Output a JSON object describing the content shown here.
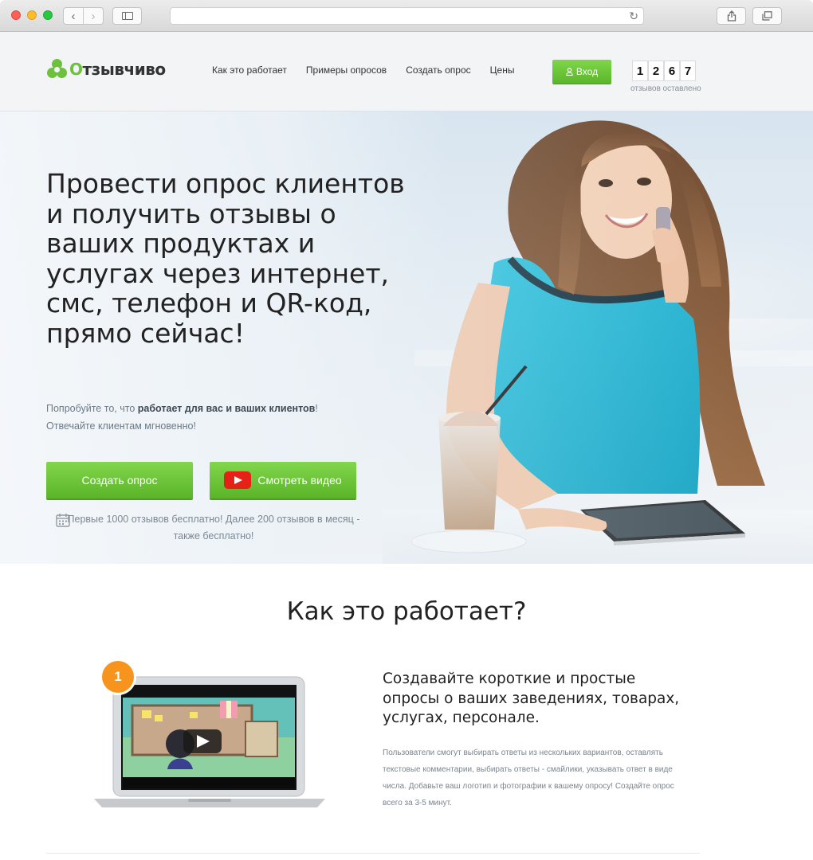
{
  "site": {
    "logo_text_green": "О",
    "logo_text_dark": "тзывчиво",
    "logo_alt": "Отзывчиво",
    "nav": [
      "Как это работает",
      "Примеры опросов",
      "Создать опрос",
      "Цены"
    ],
    "login_label": "Вход",
    "counter_digits": [
      "1",
      "2",
      "6",
      "7"
    ],
    "counter_label": "отзывов оставлено"
  },
  "hero": {
    "title": "Провести опрос клиентов и получить отзывы о ваших продуктах и услугах через интернет, смс, телефон и QR-код, прямо сейчас!",
    "subtitle_pre": "Попробуйте то, что ",
    "subtitle_bold": "работает для вас и ваших клиентов",
    "subtitle_post": "!",
    "subtitle_line2": "Отвечайте клиентам мгновенно!",
    "create_button": "Создать опрос",
    "video_button": "Смотреть видео",
    "free_note": "Первые 1000 отзывов бесплатно! Далее 200 отзывов в месяц - также бесплатно!"
  },
  "how": {
    "title": "Как это работает?",
    "step_number": "1",
    "step_title": "Создавайте короткие и простые опросы о ваших заведениях, товарах, услугах, персонале.",
    "step_desc": "Пользователи смогут выбирать ответы из нескольких вариантов, оставлять текстовые комментарии, выбирать ответы - смайлики, указывать ответ в виде числа. Добавьте ваш логотип и фотографии к вашему опросу! Создайте опрос всего за 3-5 минут."
  },
  "colors": {
    "brand_green": "#6cc23a",
    "button_green": "#5ab428",
    "step_orange": "#f7941d",
    "youtube_red": "#e62117"
  }
}
